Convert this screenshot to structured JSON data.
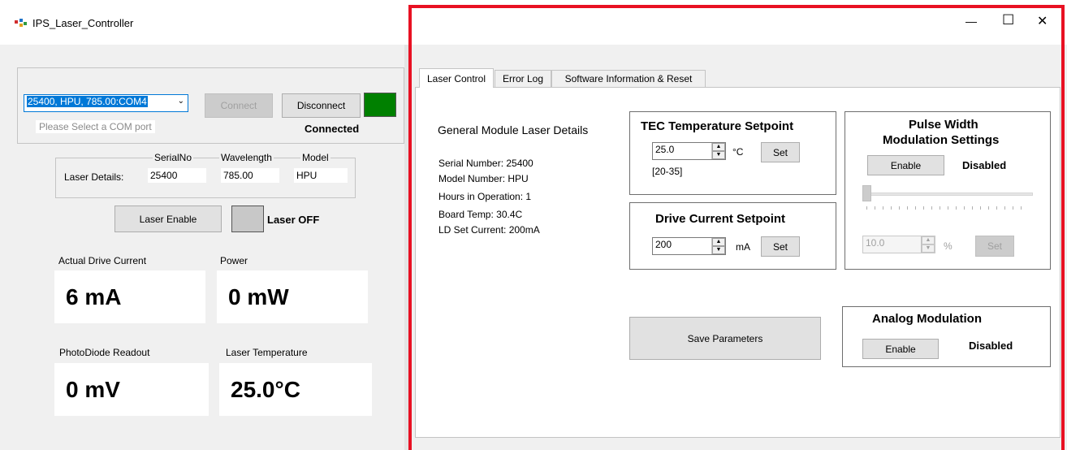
{
  "window": {
    "title": "IPS_Laser_Controller",
    "minimize_glyph": "—",
    "maximize_glyph": "☐",
    "close_glyph": "✕",
    "highlight_color": "#e81123"
  },
  "connection": {
    "com_port_value": "25400, HPU, 785.00:COM4",
    "com_port_hint": "Please Select a COM port",
    "connect_label": "Connect",
    "disconnect_label": "Disconnect",
    "status_label": "Connected",
    "status_color": "#008000"
  },
  "laser_details": {
    "label": "Laser Details:",
    "serial_header": "SerialNo",
    "wavelength_header": "Wavelength",
    "model_header": "Model",
    "serial_value": "25400",
    "wavelength_value": "785.00",
    "model_value": "HPU"
  },
  "laser_enable": {
    "button_label": "Laser Enable",
    "status_label": "Laser OFF"
  },
  "readouts": {
    "drive_current_label": "Actual Drive Current",
    "drive_current_value": "6 mA",
    "power_label": "Power",
    "power_value": "0 mW",
    "photodiode_label": "PhotoDiode Readout",
    "photodiode_value": "0 mV",
    "temperature_label": "Laser Temperature",
    "temperature_value": "25.0°C"
  },
  "tabs": [
    {
      "label": "Laser Control"
    },
    {
      "label": "Error Log"
    },
    {
      "label": "Software Information & Reset"
    }
  ],
  "general": {
    "title": "General Module Laser Details",
    "serial_line": "Serial Number:  25400",
    "model_line": "Model Number:  HPU",
    "hours_line": "Hours in Operation: 1",
    "board_temp_line": "Board Temp: 30.4C",
    "ld_current_line": "LD Set Current: 200mA"
  },
  "tec": {
    "title": "TEC Temperature Setpoint",
    "value": "25.0",
    "unit": "°C",
    "set_label": "Set",
    "range": "[20-35]"
  },
  "drive": {
    "title": "Drive Current Setpoint",
    "value": "200",
    "unit": "mA",
    "set_label": "Set"
  },
  "pwm": {
    "title_line1": "Pulse Width",
    "title_line2": "Modulation Settings",
    "enable_label": "Enable",
    "status": "Disabled",
    "value": "10.0",
    "unit": "%",
    "set_label": "Set",
    "slider_level": 0
  },
  "save": {
    "label": "Save Parameters"
  },
  "analog": {
    "title": "Analog Modulation",
    "enable_label": "Enable",
    "status": "Disabled"
  }
}
